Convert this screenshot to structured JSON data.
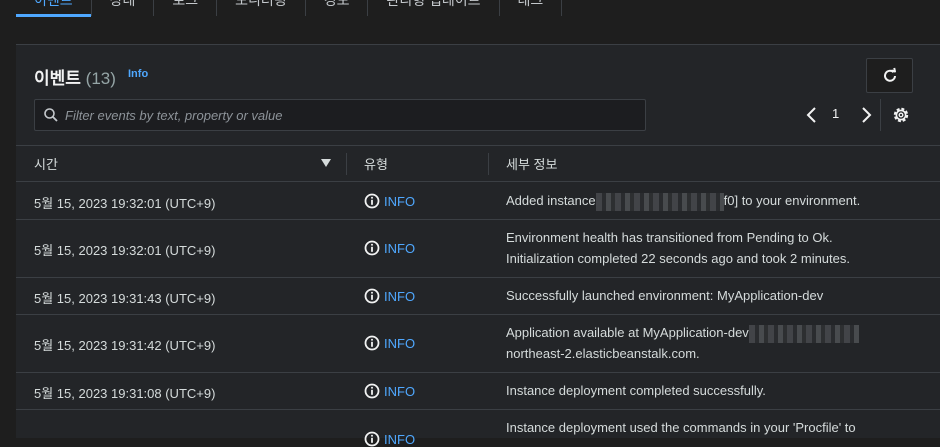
{
  "tabs": [
    {
      "label": "이벤트",
      "active": true
    },
    {
      "label": "상태",
      "active": false
    },
    {
      "label": "로그",
      "active": false
    },
    {
      "label": "모니터링",
      "active": false
    },
    {
      "label": "경보",
      "active": false
    },
    {
      "label": "관리형 업데이트",
      "active": false
    },
    {
      "label": "태그",
      "active": false
    }
  ],
  "header": {
    "title": "이벤트",
    "count": "(13)",
    "info": "Info"
  },
  "search": {
    "placeholder": "Filter events by text, property or value",
    "value": ""
  },
  "pagination": {
    "page": "1"
  },
  "columns": {
    "time": "시간",
    "type": "유형",
    "detail": "세부 정보"
  },
  "rows": [
    {
      "time": "5월 15, 2023 19:32:01 (UTC+9)",
      "type": "INFO",
      "detail_a": "Added instance",
      "detail_b": "f0] to your environment."
    },
    {
      "time": "5월 15, 2023 19:32:01 (UTC+9)",
      "type": "INFO",
      "detail_a": "Environment health has transitioned from Pending to Ok.",
      "detail_b": "Initialization completed 22 seconds ago and took 2 minutes."
    },
    {
      "time": "5월 15, 2023 19:31:43 (UTC+9)",
      "type": "INFO",
      "detail_a": "Successfully launched environment: MyApplication-dev",
      "detail_b": ""
    },
    {
      "time": "5월 15, 2023 19:31:42 (UTC+9)",
      "type": "INFO",
      "detail_a": "Application available at MyApplication-dev",
      "detail_b": "northeast-2.elasticbeanstalk.com."
    },
    {
      "time": "5월 15, 2023 19:31:08 (UTC+9)",
      "type": "INFO",
      "detail_a": "Instance deployment completed successfully.",
      "detail_b": ""
    },
    {
      "time": "",
      "type": "INFO",
      "detail_a": "Instance deployment used the commands in your 'Procfile' to",
      "detail_b": ""
    }
  ],
  "colors": {
    "accent": "#4fa8ff",
    "background": "#1e1e1e",
    "panel": "#232528",
    "border": "#3b3f44"
  },
  "icons": [
    "info-circle-icon",
    "refresh-icon",
    "search-icon",
    "chevron-left-icon",
    "chevron-right-icon",
    "gear-icon",
    "sort-down-icon"
  ]
}
